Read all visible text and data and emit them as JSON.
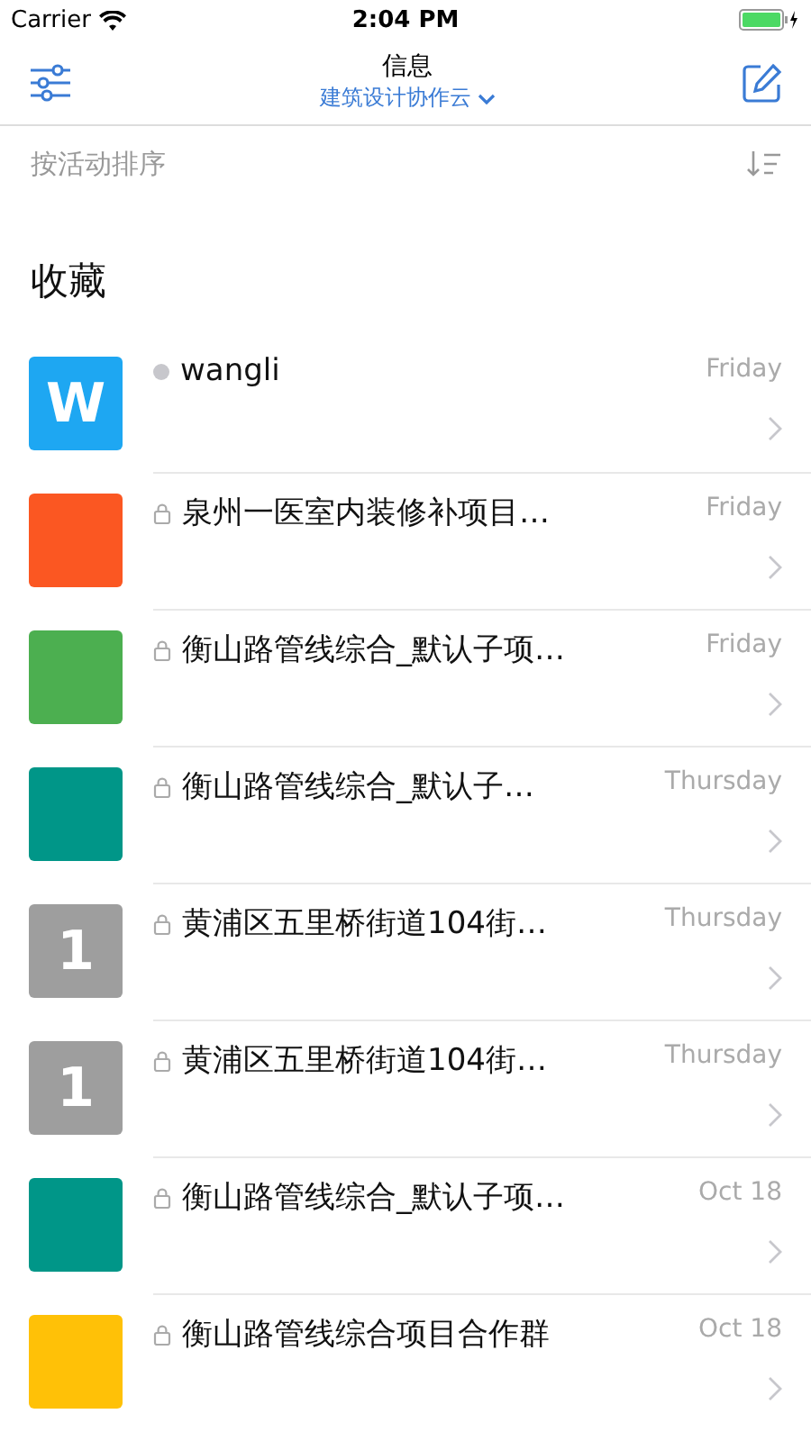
{
  "status_bar": {
    "carrier": "Carrier",
    "time": "2:04 PM"
  },
  "nav": {
    "title": "信息",
    "subtitle": "建筑设计协作云"
  },
  "sort_bar": {
    "label": "按活动排序"
  },
  "section": {
    "title": "收藏"
  },
  "conversations": [
    {
      "kind": "person",
      "name": "wangli",
      "date": "Friday",
      "avatar_text": "W",
      "color": "#1ea7f2"
    },
    {
      "kind": "group",
      "name": "泉州一医室内装修补项目…",
      "date": "Friday",
      "color": "#fb5722"
    },
    {
      "kind": "group",
      "name": "衡山路管线综合_默认子项…",
      "date": "Friday",
      "color": "#4caf50"
    },
    {
      "kind": "group",
      "name": "衡山路管线综合_默认子…",
      "date": "Thursday",
      "color": "#009688"
    },
    {
      "kind": "group",
      "name": "黄浦区五里桥街道104街…",
      "date": "Thursday",
      "avatar_text": "1",
      "color": "#9e9e9e"
    },
    {
      "kind": "group",
      "name": "黄浦区五里桥街道104街…",
      "date": "Thursday",
      "avatar_text": "1",
      "color": "#9e9e9e"
    },
    {
      "kind": "group",
      "name": "衡山路管线综合_默认子项…",
      "date": "Oct 18",
      "color": "#009688"
    },
    {
      "kind": "group",
      "name": "衡山路管线综合项目合作群",
      "date": "Oct 18",
      "color": "#ffc107"
    }
  ]
}
